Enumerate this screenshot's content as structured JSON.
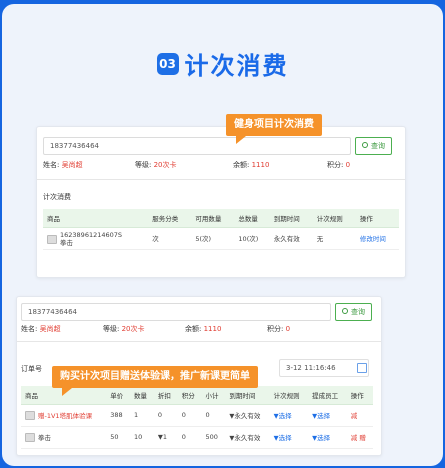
{
  "heading": {
    "number": "03",
    "title": "计次消费"
  },
  "callouts": {
    "top": "健身项目计次消费",
    "bottom": "购买计次项目赠送体验课，推广新课更简单"
  },
  "card1": {
    "phone": "18377436464",
    "search_label": "查询",
    "name_label": "姓名:",
    "name_value": "吴尚超",
    "level_label": "等级:",
    "level_value": "20次卡",
    "balance_label": "余额:",
    "balance_value": "1110",
    "points_label": "积分:",
    "points_value": "0",
    "section_label": "计次消费",
    "columns": [
      "商品",
      "服务分类",
      "可用数量",
      "总数量",
      "到期时间",
      "计次规则",
      "操作"
    ],
    "row": {
      "name_line1": "16238961214607S",
      "name_line2": "拳击",
      "category": "次",
      "available": "5(次)",
      "total": "10(次)",
      "expiry": "永久有效",
      "rule": "无",
      "action": "修改时间"
    }
  },
  "card2": {
    "phone": "18377436464",
    "search_label": "查询",
    "name_label": "姓名:",
    "name_value": "吴尚超",
    "level_label": "等级:",
    "level_value": "20次卡",
    "balance_label": "余额:",
    "balance_value": "1110",
    "points_label": "积分:",
    "points_value": "0",
    "order_label": "订单号",
    "datetime_fragment": "3-12 11:16:46",
    "columns": [
      "商品",
      "单价",
      "数量",
      "折扣",
      "积分",
      "小计",
      "到期时间",
      "计次规则",
      "提成员工",
      "操作"
    ],
    "rows": [
      {
        "name": "赠-1V1塔肌体验课",
        "price": "388",
        "qty": "1",
        "discount": "0",
        "points": "0",
        "subtotal": "0",
        "expiry": "▼永久有效",
        "rule": "▼选择",
        "staff": "▼选择",
        "action1": "减",
        "action2": ""
      },
      {
        "name": "拳击",
        "price": "50",
        "qty": "10",
        "discount": "▼1",
        "points": "0",
        "subtotal": "500",
        "expiry": "▼永久有效",
        "rule": "▼选择",
        "staff": "▼选择",
        "action1": "减",
        "action2": "赠"
      }
    ]
  }
}
